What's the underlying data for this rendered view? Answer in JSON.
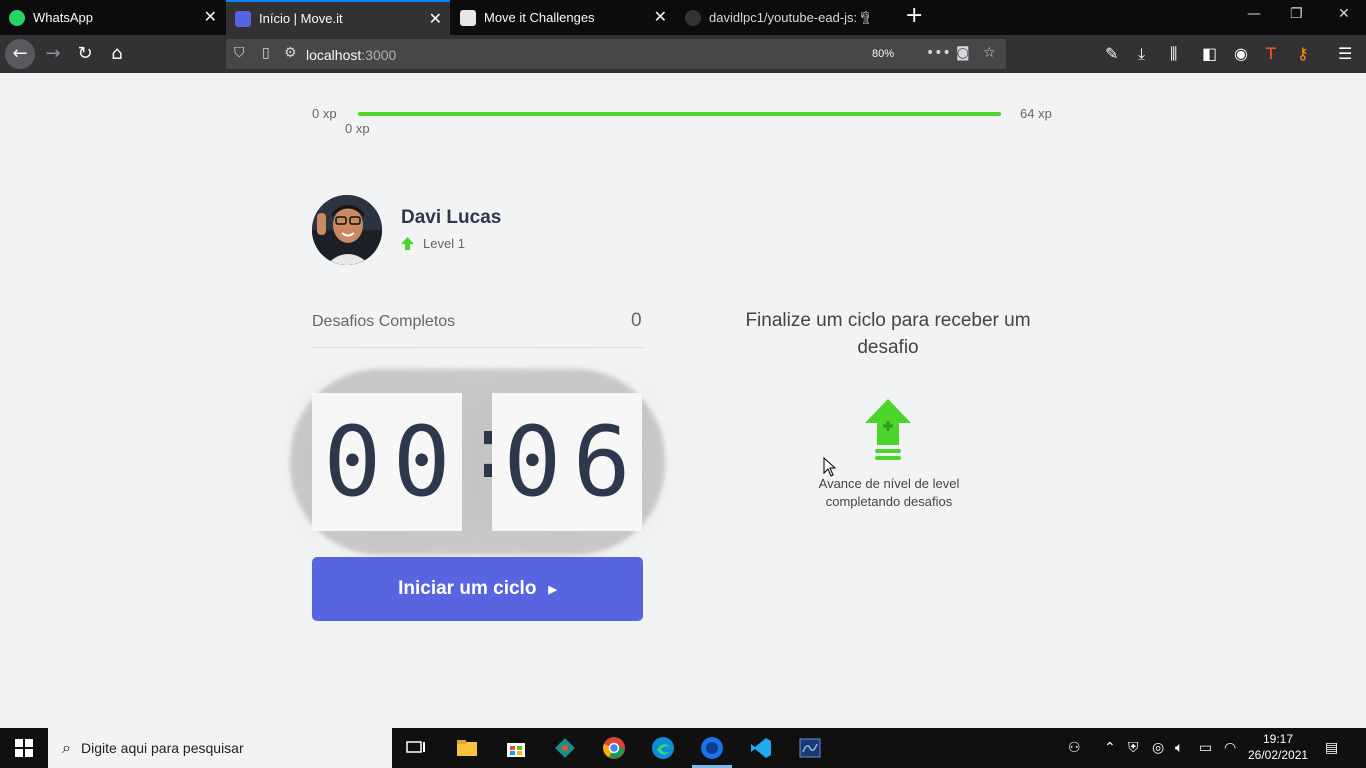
{
  "browser": {
    "tabs": [
      {
        "title": "WhatsApp",
        "active": false
      },
      {
        "title": "Início | Move.it",
        "active": true
      },
      {
        "title": "Move it Challenges",
        "active": false
      },
      {
        "title": "davidlpc1/youtube-ead-js: 🏗",
        "active": false
      }
    ],
    "url_host": "localhost",
    "url_port": ":3000",
    "zoom": "80%"
  },
  "xp": {
    "min_label": "0 xp",
    "max_label": "64 xp",
    "current_label": "0 xp",
    "progress_percent": 100
  },
  "profile": {
    "name": "Davi Lucas",
    "level": "Level 1"
  },
  "challenges": {
    "label": "Desafios Completos",
    "count": "0"
  },
  "countdown": {
    "minute_left": "0",
    "minute_right": "0",
    "colon": ":",
    "second_left": "0",
    "second_right": "6"
  },
  "start_button": {
    "label": "Iniciar um ciclo",
    "arrow": "▶"
  },
  "challenge_box": {
    "title": "Finalize um ciclo para receber um desafio",
    "description": "Avance de nível de level completando desafios"
  },
  "taskbar": {
    "search_placeholder": "Digite aqui para pesquisar",
    "time": "19:17",
    "date": "26/02/2021"
  },
  "colors": {
    "accent": "#5965e0",
    "green": "#4cd62b",
    "text_dark": "#2e384d",
    "background": "#f2f3f5"
  }
}
